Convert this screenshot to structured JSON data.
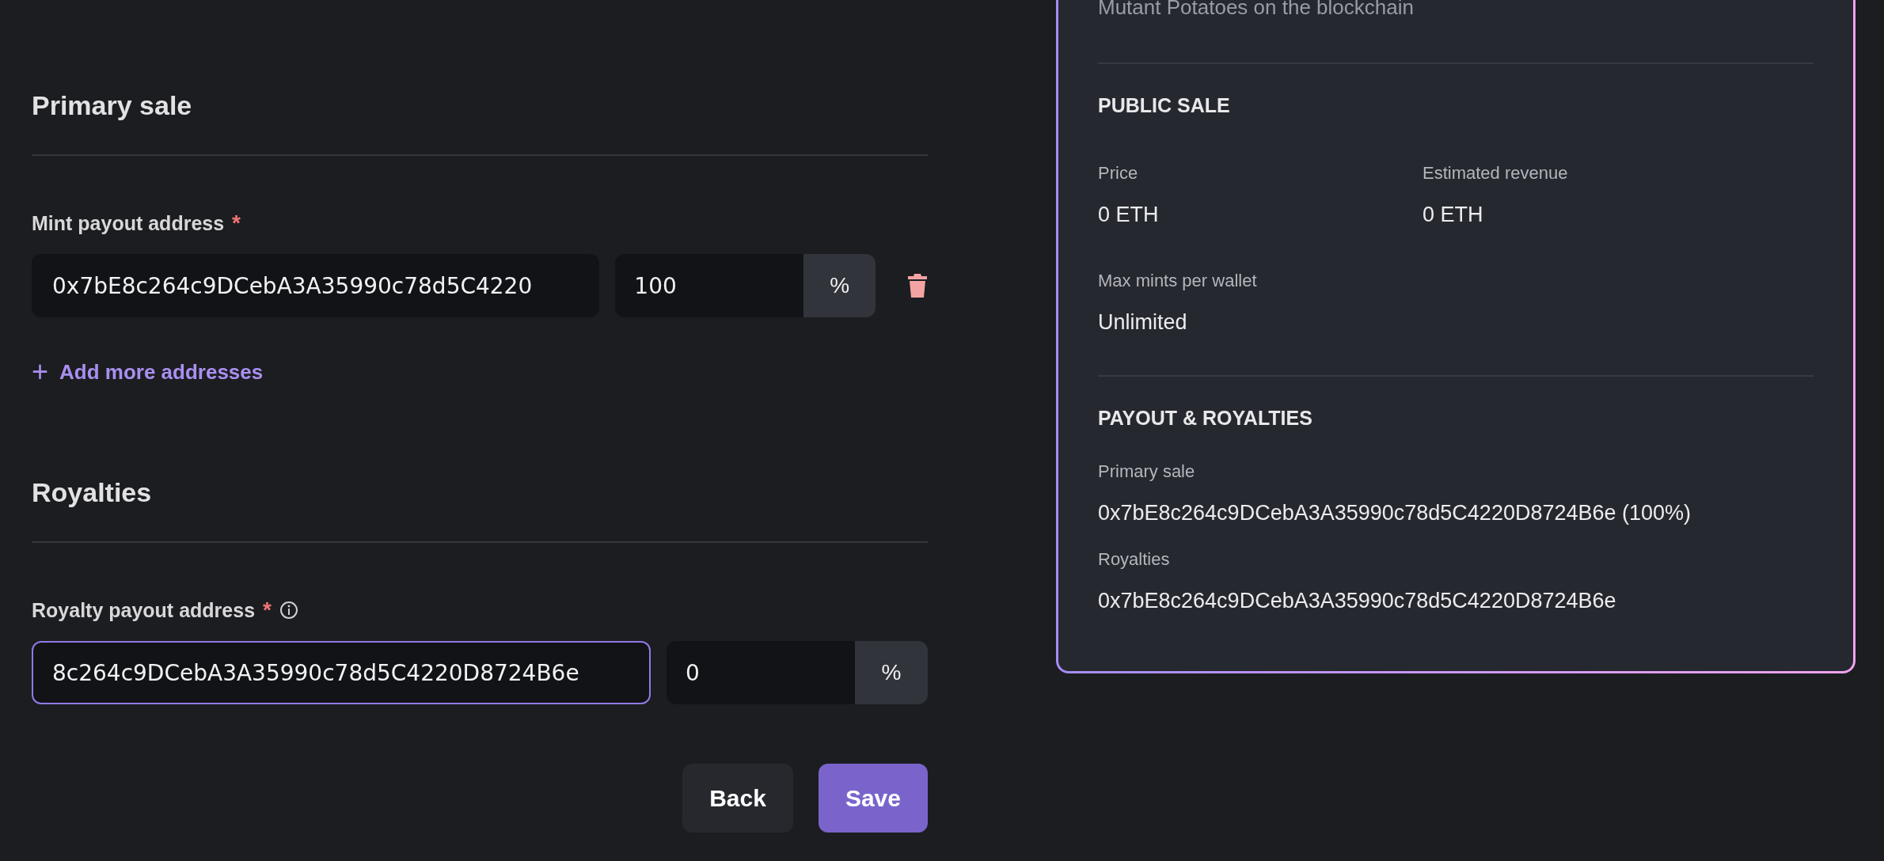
{
  "primary_sale": {
    "heading": "Primary sale",
    "field_label": "Mint payout address",
    "required_mark": "*",
    "info": false,
    "payouts": [
      {
        "address": "0x7bE8c264c9DCebA3A35990c78d5C4220",
        "percent": "100",
        "unit": "%",
        "focused": false,
        "deletable": true
      }
    ],
    "add_link": {
      "icon": "+",
      "label": "Add more addresses"
    }
  },
  "royalties": {
    "heading": "Royalties",
    "field_label": "Royalty payout address",
    "required_mark": "*",
    "info": true,
    "payouts": [
      {
        "address": "8c264c9DCebA3A35990c78d5C4220D8724B6e",
        "percent": "0",
        "unit": "%",
        "focused": true,
        "deletable": false
      }
    ]
  },
  "buttons": [
    {
      "label": "Back",
      "kind": "secondary"
    },
    {
      "label": "Save",
      "kind": "primary"
    }
  ],
  "summary": {
    "description": "Mutant Potatoes on the blockchain",
    "sections": [
      {
        "heading": "PUBLIC SALE",
        "kind": "grid",
        "fields": [
          {
            "label": "Price",
            "value": "0 ETH"
          },
          {
            "label": "Estimated revenue",
            "value": "0 ETH"
          },
          {
            "label": "Max mints per wallet",
            "value": "Unlimited"
          }
        ]
      },
      {
        "heading": "PAYOUT & ROYALTIES",
        "kind": "list",
        "fields": [
          {
            "label": "Primary sale",
            "value": "0x7bE8c264c9DCebA3A35990c78d5C4220D8724B6e (100%)"
          },
          {
            "label": "Royalties",
            "value": "0x7bE8c264c9DCebA3A35990c78d5C4220D8724B6e"
          }
        ]
      }
    ]
  }
}
